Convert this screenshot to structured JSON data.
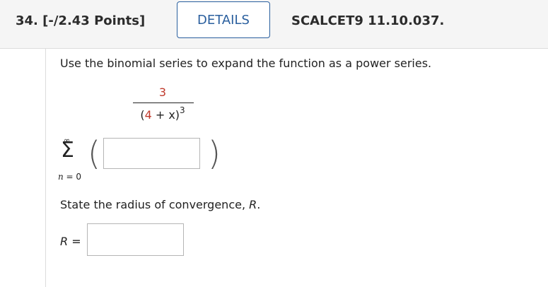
{
  "header": {
    "question_label": "34.  [-/2.43 Points]",
    "details_label": "DETAILS",
    "problem_code": "SCALCET9 11.10.037."
  },
  "problem": {
    "instruction": "Use the binomial series to expand the function as a power series.",
    "numerator": "3",
    "denom_open": "(",
    "denom_four": "4",
    "denom_plus_x": " + x)",
    "denom_exponent": "3",
    "sum_upper": "∞",
    "sum_symbol": "Σ",
    "sum_lower_var": "n",
    "sum_lower_rest": " = 0",
    "left_paren": "(",
    "right_paren": ")",
    "radius_prompt": "State the radius of convergence, ",
    "radius_var": "R",
    "radius_period": ".",
    "r_label_var": "R",
    "r_label_eq": " ="
  },
  "colors": {
    "accent": "#2a5f9e",
    "highlight": "#c0392b"
  },
  "inputs": {
    "series_answer": "",
    "radius_answer": ""
  }
}
